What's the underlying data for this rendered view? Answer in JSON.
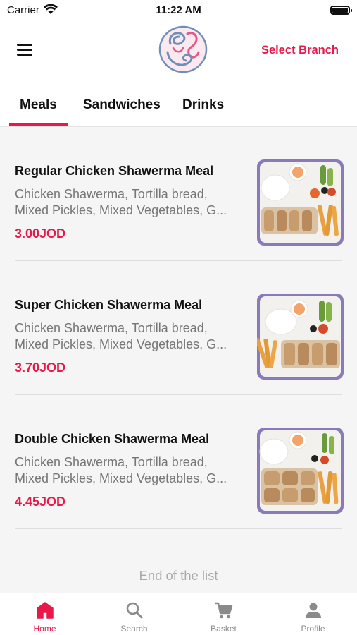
{
  "status_bar": {
    "carrier": "Carrier",
    "time": "11:22 AM"
  },
  "header": {
    "select_branch": "Select Branch"
  },
  "tabs": [
    {
      "label": "Meals",
      "active": true
    },
    {
      "label": "Sandwiches",
      "active": false
    },
    {
      "label": "Drinks",
      "active": false
    }
  ],
  "meals": [
    {
      "title": "Regular Chicken Shawerma Meal",
      "desc_line1": "Chicken Shawerma, Tortilla bread,",
      "desc_line2": "Mixed Pickles, Mixed Vegetables, G...",
      "price": "3.00JOD"
    },
    {
      "title": "Super Chicken Shawerma Meal",
      "desc_line1": "Chicken Shawerma, Tortilla bread,",
      "desc_line2": "Mixed Pickles, Mixed Vegetables, G...",
      "price": "3.70JOD"
    },
    {
      "title": "Double Chicken Shawerma Meal",
      "desc_line1": "Chicken Shawerma, Tortilla bread,",
      "desc_line2": "Mixed Pickles, Mixed Vegetables, G...",
      "price": "4.45JOD"
    }
  ],
  "end_of_list": "End of the list",
  "tabbar": [
    {
      "label": "Home",
      "icon": "home-icon",
      "active": true
    },
    {
      "label": "Search",
      "icon": "search-icon",
      "active": false
    },
    {
      "label": "Basket",
      "icon": "cart-icon",
      "active": false
    },
    {
      "label": "Profile",
      "icon": "person-icon",
      "active": false
    }
  ],
  "colors": {
    "accent": "#e8194a",
    "tray": "#8a7ab8",
    "muted": "#8a8a8a"
  }
}
